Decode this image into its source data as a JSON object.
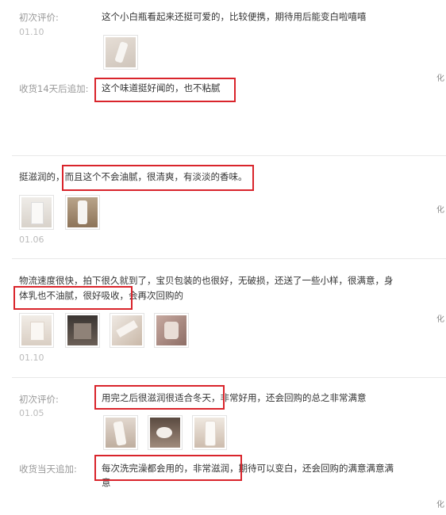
{
  "reviews": [
    {
      "label": "初次评价:",
      "date": "01.10",
      "text": "这个小白瓶看起来还挺可爱的，比较便携，期待用后能变白啦嘻嘻",
      "followup_label": "收货14天后追加:",
      "followup_text": "这个味道挺好闻的，也不粘腻",
      "side_mark": "化"
    },
    {
      "text_before": "挺滋润的，",
      "text_highlight": "而且这个不会油腻，很清爽，有淡淡的香味。",
      "date": "01.06",
      "side_mark": "化"
    },
    {
      "line1": "物流速度很快，拍下很久就到了，宝贝包装的也很好，无破损，还送了一些小样，很满意，身",
      "line2_highlight": "体乳也不油腻，很好吸收，",
      "line2_rest": "会再次回购的",
      "date": "01.10",
      "side_mark": "化"
    },
    {
      "label": "初次评价:",
      "date": "01.05",
      "text_highlight": "用完之后很滋润很适合冬天，",
      "text_rest": "非常好用，还会回购的总之非常满意",
      "followup_label": "收货当天追加:",
      "followup_highlight": "每次洗完澡都会用的，非常滋润，",
      "followup_rest": "期待可以变白，还会回购的满意满意满",
      "followup_wrap": "意",
      "side_mark": "化"
    }
  ],
  "colors": {
    "highlight_box": "#d9242b",
    "label": "#999999",
    "divider": "#e8e8e8"
  }
}
